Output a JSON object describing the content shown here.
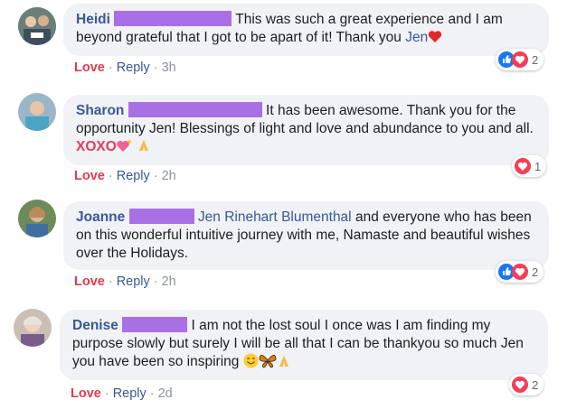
{
  "comments": [
    {
      "author": "Heidi",
      "text_before": "This was such a great experience and I am beyond grateful that I got to be apart of it! Thank you ",
      "mention": "Jen",
      "reaction_count": "2",
      "time": "3h"
    },
    {
      "author": "Sharon",
      "text_before": "It has been awesome. Thank you for the opportunity Jen! Blessings of light and love and abundance to you and all. ",
      "highlight": "XOXO",
      "reaction_count": "1",
      "time": "2h"
    },
    {
      "author": "Joanne",
      "mention": "Jen Rinehart Blumenthal",
      "text_after": " and everyone who has been on this wonderful intuitive journey with me, Namaste and beautiful wishes over the Holidays.",
      "reaction_count": "2",
      "time": "2h"
    },
    {
      "author": "Denise",
      "text_before": "I am not the lost soul I once was I am finding my purpose slowly but surely I will be all that I can be thankyou so much Jen you have been so inspiring ",
      "reaction_count": "2",
      "time": "2d"
    }
  ],
  "actions": {
    "love": "Love",
    "reply": "Reply",
    "sep": "·"
  },
  "colors": {
    "author": "#385898",
    "love": "#e6394d",
    "bubble": "#f0f2f5",
    "redaction": "#a970e6"
  },
  "icons": [
    "like-icon",
    "heart-icon",
    "sparkling-heart-emoji",
    "praying-hands-emoji",
    "smiling-face-emoji",
    "butterfly-emoji"
  ]
}
